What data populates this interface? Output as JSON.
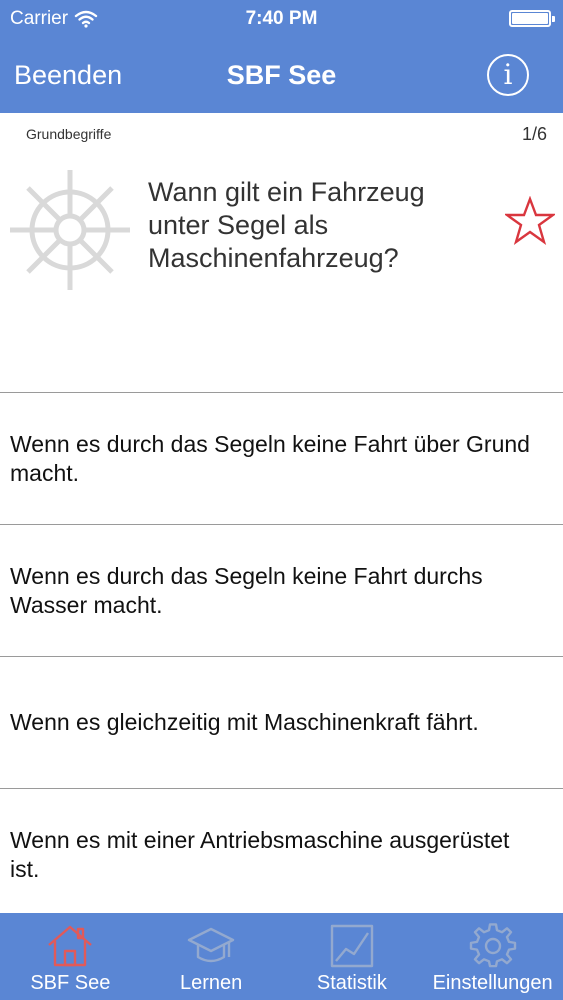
{
  "status": {
    "carrier": "Carrier",
    "time": "7:40 PM"
  },
  "nav": {
    "back_label": "Beenden",
    "title": "SBF See",
    "info_glyph": "i"
  },
  "question": {
    "category": "Grundbegriffe",
    "counter": "1/6",
    "text": "Wann gilt ein Fahrzeug unter Segel als Maschinenfahrzeug?"
  },
  "answers": [
    "Wenn es durch das Segeln keine Fahrt über Grund macht.",
    "Wenn es durch das Segeln keine Fahrt durchs Wasser macht.",
    "Wenn es gleichzeitig mit Maschinenkraft fährt.",
    "Wenn es mit einer Antriebsmaschine ausgerüstet ist."
  ],
  "tabs": [
    {
      "label": "SBF See",
      "icon": "home-icon",
      "active": true
    },
    {
      "label": "Lernen",
      "icon": "graduation-cap-icon",
      "active": false
    },
    {
      "label": "Statistik",
      "icon": "chart-icon",
      "active": false
    },
    {
      "label": "Einstellungen",
      "icon": "gear-icon",
      "active": false
    }
  ],
  "colors": {
    "bar": "#5a86d4",
    "active_icon": "#e05a5a",
    "star": "#d9363e",
    "wheel": "#d9d9d9"
  }
}
